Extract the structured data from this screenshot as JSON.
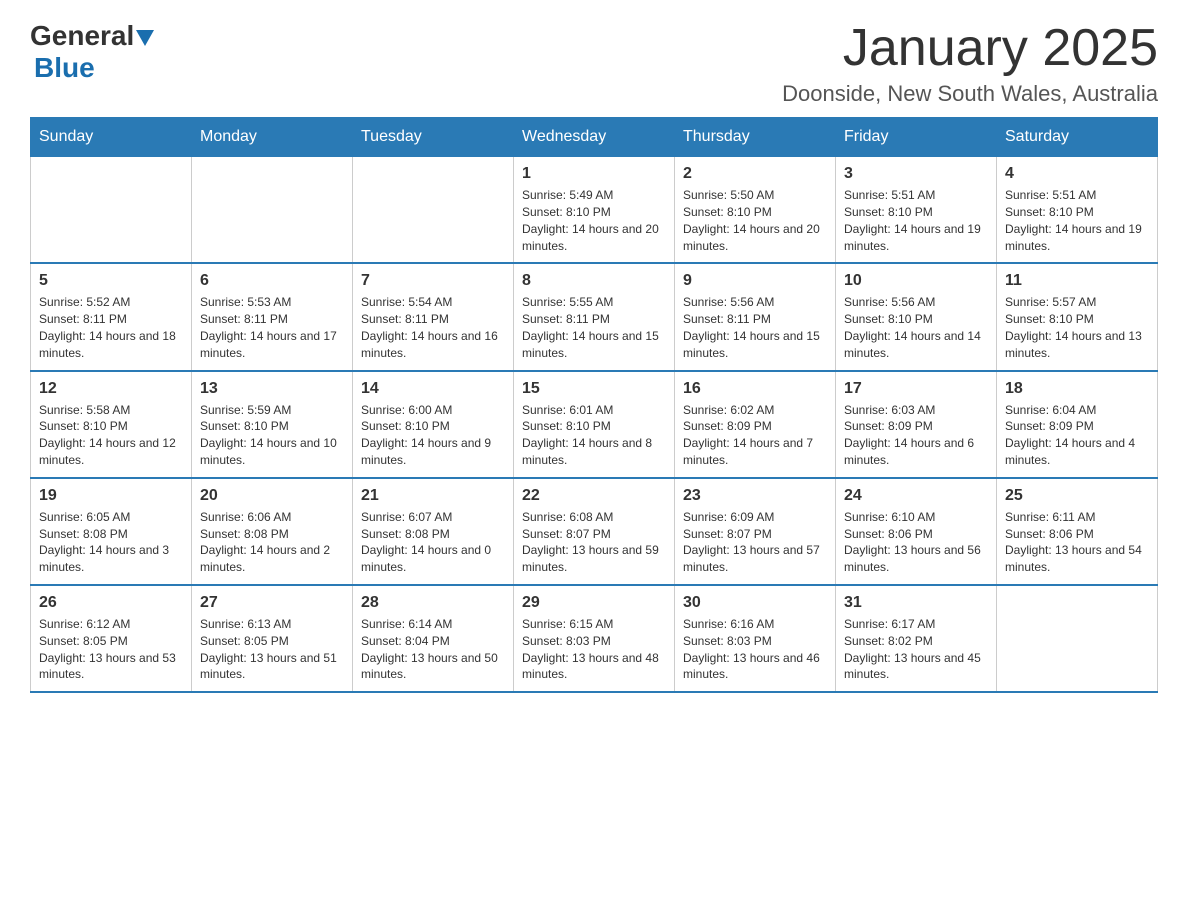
{
  "logo": {
    "text_black": "General",
    "text_blue": "Blue"
  },
  "title": "January 2025",
  "location": "Doonside, New South Wales, Australia",
  "days_of_week": [
    "Sunday",
    "Monday",
    "Tuesday",
    "Wednesday",
    "Thursday",
    "Friday",
    "Saturday"
  ],
  "weeks": [
    [
      {
        "day": "",
        "info": ""
      },
      {
        "day": "",
        "info": ""
      },
      {
        "day": "",
        "info": ""
      },
      {
        "day": "1",
        "sunrise": "5:49 AM",
        "sunset": "8:10 PM",
        "daylight": "14 hours and 20 minutes."
      },
      {
        "day": "2",
        "sunrise": "5:50 AM",
        "sunset": "8:10 PM",
        "daylight": "14 hours and 20 minutes."
      },
      {
        "day": "3",
        "sunrise": "5:51 AM",
        "sunset": "8:10 PM",
        "daylight": "14 hours and 19 minutes."
      },
      {
        "day": "4",
        "sunrise": "5:51 AM",
        "sunset": "8:10 PM",
        "daylight": "14 hours and 19 minutes."
      }
    ],
    [
      {
        "day": "5",
        "sunrise": "5:52 AM",
        "sunset": "8:11 PM",
        "daylight": "14 hours and 18 minutes."
      },
      {
        "day": "6",
        "sunrise": "5:53 AM",
        "sunset": "8:11 PM",
        "daylight": "14 hours and 17 minutes."
      },
      {
        "day": "7",
        "sunrise": "5:54 AM",
        "sunset": "8:11 PM",
        "daylight": "14 hours and 16 minutes."
      },
      {
        "day": "8",
        "sunrise": "5:55 AM",
        "sunset": "8:11 PM",
        "daylight": "14 hours and 15 minutes."
      },
      {
        "day": "9",
        "sunrise": "5:56 AM",
        "sunset": "8:11 PM",
        "daylight": "14 hours and 15 minutes."
      },
      {
        "day": "10",
        "sunrise": "5:56 AM",
        "sunset": "8:10 PM",
        "daylight": "14 hours and 14 minutes."
      },
      {
        "day": "11",
        "sunrise": "5:57 AM",
        "sunset": "8:10 PM",
        "daylight": "14 hours and 13 minutes."
      }
    ],
    [
      {
        "day": "12",
        "sunrise": "5:58 AM",
        "sunset": "8:10 PM",
        "daylight": "14 hours and 12 minutes."
      },
      {
        "day": "13",
        "sunrise": "5:59 AM",
        "sunset": "8:10 PM",
        "daylight": "14 hours and 10 minutes."
      },
      {
        "day": "14",
        "sunrise": "6:00 AM",
        "sunset": "8:10 PM",
        "daylight": "14 hours and 9 minutes."
      },
      {
        "day": "15",
        "sunrise": "6:01 AM",
        "sunset": "8:10 PM",
        "daylight": "14 hours and 8 minutes."
      },
      {
        "day": "16",
        "sunrise": "6:02 AM",
        "sunset": "8:09 PM",
        "daylight": "14 hours and 7 minutes."
      },
      {
        "day": "17",
        "sunrise": "6:03 AM",
        "sunset": "8:09 PM",
        "daylight": "14 hours and 6 minutes."
      },
      {
        "day": "18",
        "sunrise": "6:04 AM",
        "sunset": "8:09 PM",
        "daylight": "14 hours and 4 minutes."
      }
    ],
    [
      {
        "day": "19",
        "sunrise": "6:05 AM",
        "sunset": "8:08 PM",
        "daylight": "14 hours and 3 minutes."
      },
      {
        "day": "20",
        "sunrise": "6:06 AM",
        "sunset": "8:08 PM",
        "daylight": "14 hours and 2 minutes."
      },
      {
        "day": "21",
        "sunrise": "6:07 AM",
        "sunset": "8:08 PM",
        "daylight": "14 hours and 0 minutes."
      },
      {
        "day": "22",
        "sunrise": "6:08 AM",
        "sunset": "8:07 PM",
        "daylight": "13 hours and 59 minutes."
      },
      {
        "day": "23",
        "sunrise": "6:09 AM",
        "sunset": "8:07 PM",
        "daylight": "13 hours and 57 minutes."
      },
      {
        "day": "24",
        "sunrise": "6:10 AM",
        "sunset": "8:06 PM",
        "daylight": "13 hours and 56 minutes."
      },
      {
        "day": "25",
        "sunrise": "6:11 AM",
        "sunset": "8:06 PM",
        "daylight": "13 hours and 54 minutes."
      }
    ],
    [
      {
        "day": "26",
        "sunrise": "6:12 AM",
        "sunset": "8:05 PM",
        "daylight": "13 hours and 53 minutes."
      },
      {
        "day": "27",
        "sunrise": "6:13 AM",
        "sunset": "8:05 PM",
        "daylight": "13 hours and 51 minutes."
      },
      {
        "day": "28",
        "sunrise": "6:14 AM",
        "sunset": "8:04 PM",
        "daylight": "13 hours and 50 minutes."
      },
      {
        "day": "29",
        "sunrise": "6:15 AM",
        "sunset": "8:03 PM",
        "daylight": "13 hours and 48 minutes."
      },
      {
        "day": "30",
        "sunrise": "6:16 AM",
        "sunset": "8:03 PM",
        "daylight": "13 hours and 46 minutes."
      },
      {
        "day": "31",
        "sunrise": "6:17 AM",
        "sunset": "8:02 PM",
        "daylight": "13 hours and 45 minutes."
      },
      {
        "day": "",
        "info": ""
      }
    ]
  ]
}
